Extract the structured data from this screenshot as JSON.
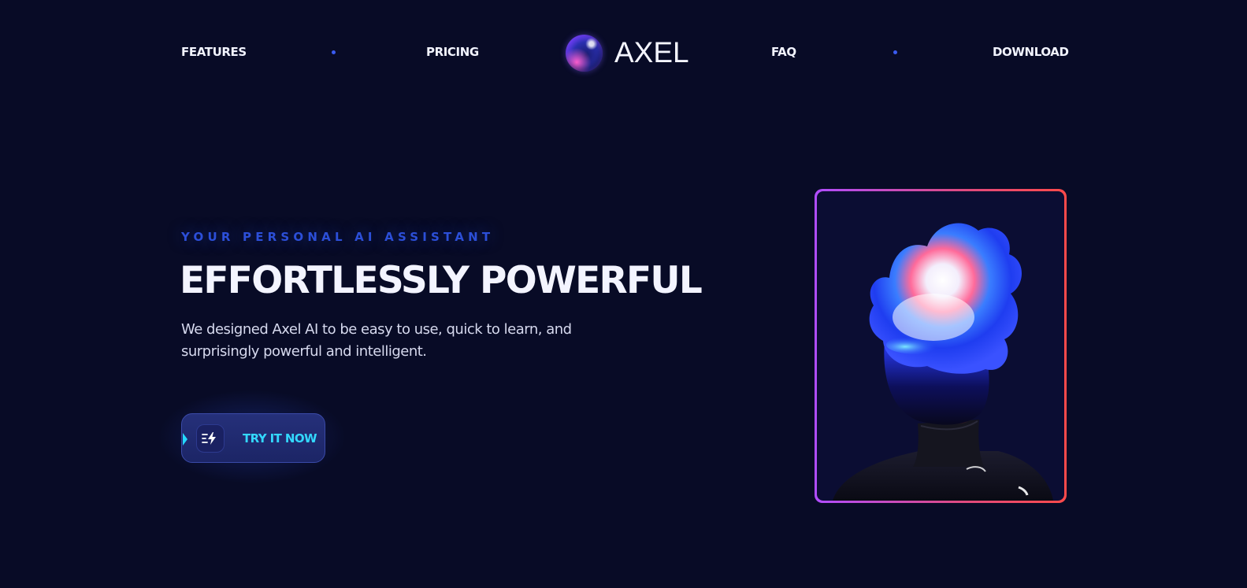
{
  "nav": {
    "left_items": [
      {
        "label": "FEATURES"
      },
      {
        "label": "PRICING"
      }
    ],
    "right_items": [
      {
        "label": "FAQ"
      },
      {
        "label": "DOWNLOAD"
      }
    ],
    "brand": {
      "name": "AXEL",
      "logo_icon": "gradient-orb-icon"
    },
    "separator_color": "#3a5bf0"
  },
  "hero": {
    "eyebrow": "YOUR PERSONAL AI ASSISTANT",
    "headline": "EFFORTLESSLY POWERFUL",
    "subtext": "We designed Axel AI to be easy to use, quick to learn, and surprisingly powerful and intelligent.",
    "cta": {
      "label": "TRY IT NOW",
      "icon": "fast-lightning-icon"
    },
    "image": {
      "subject": "holographic-head-figure",
      "border_gradient": [
        "#b04dff",
        "#ff4a4a"
      ]
    }
  },
  "colors": {
    "background": "#080b26",
    "accent_blue": "#2c4fd8",
    "cta_text": "#33d8ff",
    "headline": "#f3f4ff"
  }
}
